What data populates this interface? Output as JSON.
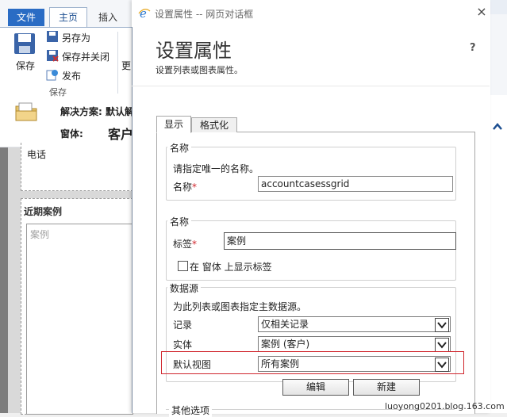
{
  "background_app": {
    "tabs": {
      "file": "文件",
      "home": "主页",
      "insert": "插入"
    },
    "ribbon": {
      "save": "保存",
      "save_as": "另存为",
      "save_and_close": "保存并关闭",
      "publish": "发布",
      "group_save": "保存",
      "more": "更"
    },
    "solution_label": "解决方案: 默认解",
    "form_label": "窗体:",
    "form_name": "客户",
    "phone_label": "电话",
    "recent_cases_label": "近期案例",
    "grid_placeholder": "案例"
  },
  "dialog": {
    "title": "设置属性 -- 网页对话框",
    "close_glyph": "×",
    "heading": "设置属性",
    "subtitle": "设置列表或图表属性。",
    "help": "?",
    "tabs": [
      "显示",
      "格式化"
    ],
    "name_group": {
      "legend": "名称",
      "description": "请指定唯一的名称。",
      "label": "名称",
      "required": "*",
      "value": "accountcasessgrid"
    },
    "label_group": {
      "legend": "名称",
      "label": "标签",
      "required": "*",
      "value": "案例",
      "checkbox_label": "在 窗体 上显示标签",
      "checkbox_checked": false
    },
    "datasource_group": {
      "legend": "数据源",
      "description": "为此列表或图表指定主数据源。",
      "records_label": "记录",
      "records_value": "仅相关记录",
      "entity_label": "实体",
      "entity_value": "案例 (客户)",
      "default_view_label": "默认视图",
      "default_view_value": "所有案例",
      "edit_button": "编辑",
      "new_button": "新建"
    },
    "other_options_legend": "其他选项"
  },
  "watermark": "luoyong0201.blog.163.com",
  "colors": {
    "accent": "#2a6cc4",
    "highlight": "#d0262d",
    "required": "#d0262d"
  }
}
